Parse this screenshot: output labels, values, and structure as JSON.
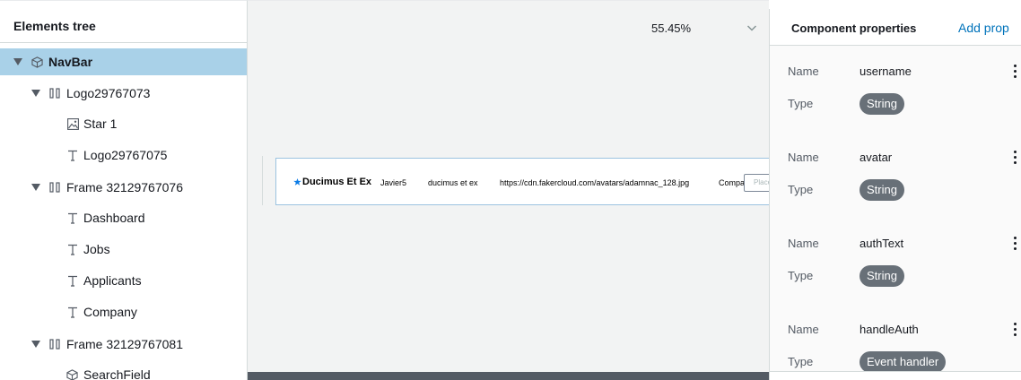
{
  "elements_tree": {
    "title": "Elements tree",
    "nodes": [
      {
        "label": "NavBar",
        "icon": "component-icon",
        "expandable": true,
        "selected": true
      },
      {
        "label": "Logo29767073",
        "icon": "frame-icon",
        "expandable": true
      },
      {
        "label": "Star 1",
        "icon": "image-icon"
      },
      {
        "label": "Logo29767075",
        "icon": "text-icon"
      },
      {
        "label": "Frame 32129767076",
        "icon": "frame-icon",
        "expandable": true
      },
      {
        "label": "Dashboard",
        "icon": "text-icon"
      },
      {
        "label": "Jobs",
        "icon": "text-icon"
      },
      {
        "label": "Applicants",
        "icon": "text-icon"
      },
      {
        "label": "Company",
        "icon": "text-icon"
      },
      {
        "label": "Frame 32129767081",
        "icon": "frame-icon",
        "expandable": true
      },
      {
        "label": "SearchField",
        "icon": "component-icon"
      }
    ]
  },
  "canvas": {
    "zoom": "55.45%",
    "preview": {
      "brand": "Ducimus Et Ex",
      "username": "Javier5",
      "auth_text": "ducimus et ex",
      "avatar_url": "https://cdn.fakercloud.com/avatars/adamnac_128.jpg",
      "company": "Company",
      "search_placeholder": "Place"
    }
  },
  "properties": {
    "title": "Component properties",
    "add_label": "Add prop",
    "name_label": "Name",
    "type_label": "Type",
    "items": [
      {
        "name": "username",
        "type": "String"
      },
      {
        "name": "avatar",
        "type": "String"
      },
      {
        "name": "authText",
        "type": "String"
      },
      {
        "name": "handleAuth",
        "type": "Event handler"
      }
    ]
  },
  "colors": {
    "selection": "#a9d1e8",
    "link": "#0073bb",
    "badge": "#687078",
    "accent_star": "#0c7ce6"
  }
}
